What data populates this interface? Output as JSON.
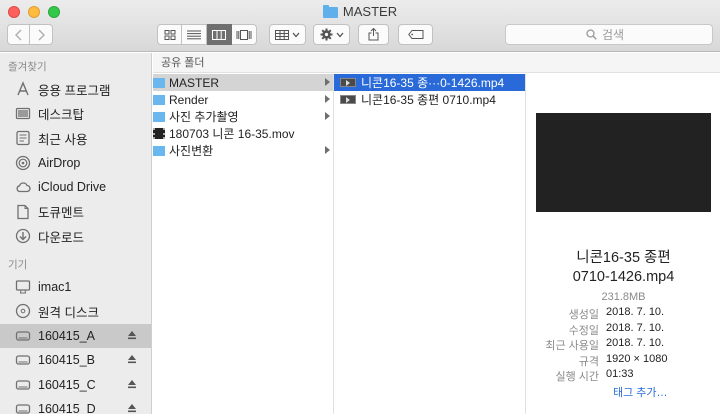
{
  "window": {
    "title": "MASTER"
  },
  "toolbar": {
    "search_placeholder": "검색"
  },
  "sidebar": {
    "favorites_header": "즐겨찾기",
    "favorites": [
      {
        "label": "응용 프로그램",
        "icon": "applications-icon"
      },
      {
        "label": "데스크탑",
        "icon": "desktop-icon"
      },
      {
        "label": "최근 사용",
        "icon": "recents-icon"
      },
      {
        "label": "AirDrop",
        "icon": "airdrop-icon"
      },
      {
        "label": "iCloud Drive",
        "icon": "cloud-icon"
      },
      {
        "label": "도큐멘트",
        "icon": "documents-icon"
      },
      {
        "label": "다운로드",
        "icon": "downloads-icon"
      }
    ],
    "devices_header": "기기",
    "devices": [
      {
        "label": "imac1",
        "icon": "imac-icon"
      },
      {
        "label": "원격 디스크",
        "icon": "remote-disc-icon"
      },
      {
        "label": "160415_A",
        "icon": "drive-icon",
        "eject": true,
        "selected": true
      },
      {
        "label": "160415_B",
        "icon": "drive-icon",
        "eject": true
      },
      {
        "label": "160415_C",
        "icon": "drive-icon",
        "eject": true
      },
      {
        "label": "160415_D",
        "icon": "drive-icon",
        "eject": true
      }
    ]
  },
  "path_header": "공유 폴더",
  "column1": [
    {
      "label": "MASTER",
      "kind": "folder",
      "has_children": true,
      "selected": true
    },
    {
      "label": "Render",
      "kind": "folder",
      "has_children": true
    },
    {
      "label": "사진 추가촬영",
      "kind": "folder",
      "has_children": true
    },
    {
      "label": "180703 니콘 16-35.mov",
      "kind": "movie",
      "has_children": false
    },
    {
      "label": "사진변환",
      "kind": "folder",
      "has_children": true
    }
  ],
  "column2": [
    {
      "label": "니콘16-35 종···0-1426.mp4",
      "kind": "video",
      "selected": true
    },
    {
      "label": "니콘16-35 종편 0710.mp4",
      "kind": "video"
    }
  ],
  "preview": {
    "name_line1": "니콘16-35 종편",
    "name_line2": "0710-1426.mp4",
    "size": "231.8MB",
    "meta": [
      {
        "key": "생성일",
        "value": "2018. 7. 10."
      },
      {
        "key": "수정일",
        "value": "2018. 7. 10."
      },
      {
        "key": "최근 사용일",
        "value": "2018. 7. 10."
      },
      {
        "key": "규격",
        "value": "1920 × 1080"
      },
      {
        "key": "실행 시간",
        "value": "01:33"
      }
    ],
    "tag_link": "태그 추가…"
  }
}
